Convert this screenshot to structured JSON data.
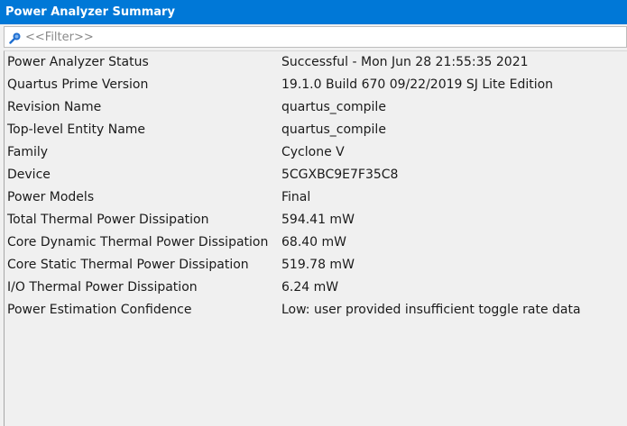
{
  "window": {
    "title": "Power Analyzer Summary"
  },
  "filter": {
    "placeholder": "<<Filter>>",
    "value": ""
  },
  "rows": [
    {
      "name": "Power Analyzer Status",
      "value": "Successful - Mon Jun 28 21:55:35 2021"
    },
    {
      "name": "Quartus Prime Version",
      "value": "19.1.0 Build 670 09/22/2019 SJ Lite Edition"
    },
    {
      "name": "Revision Name",
      "value": "quartus_compile"
    },
    {
      "name": "Top-level Entity Name",
      "value": "quartus_compile"
    },
    {
      "name": "Family",
      "value": "Cyclone V"
    },
    {
      "name": "Device",
      "value": "5CGXBC9E7F35C8"
    },
    {
      "name": "Power Models",
      "value": "Final"
    },
    {
      "name": "Total Thermal Power Dissipation",
      "value": "594.41 mW"
    },
    {
      "name": "Core Dynamic Thermal Power Dissipation",
      "value": "68.40 mW"
    },
    {
      "name": "Core Static Thermal Power Dissipation",
      "value": "519.78 mW"
    },
    {
      "name": "I/O Thermal Power Dissipation",
      "value": "6.24 mW"
    },
    {
      "name": "Power Estimation Confidence",
      "value": "Low: user provided insufficient toggle rate data"
    }
  ],
  "colors": {
    "titlebar": "#0078d7",
    "search_icon": "#1f6fd1"
  },
  "icons": {
    "filter": "search-icon"
  }
}
